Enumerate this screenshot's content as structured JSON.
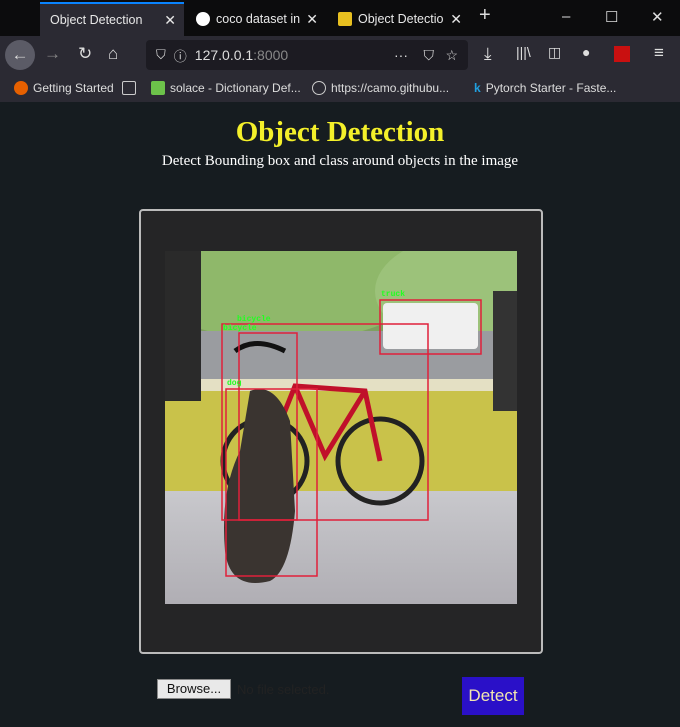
{
  "browser": {
    "tabs": [
      {
        "title": "Object Detection",
        "active": true
      },
      {
        "title": "coco dataset in",
        "active": false
      },
      {
        "title": "Object Detectio",
        "active": false
      }
    ],
    "url_host": "127.0.0.1",
    "url_port": ":8000",
    "bookmarks": [
      "Getting Started",
      "solace - Dictionary Def...",
      "https://camo.githubu...",
      "Pytorch Starter - Faste..."
    ]
  },
  "page": {
    "title": "Object Detection",
    "subtitle": "Detect Bounding box and class around objects in the image",
    "detections": [
      {
        "label": "truck"
      },
      {
        "label": "bicycle"
      },
      {
        "label": "bicycle"
      },
      {
        "label": "dog"
      }
    ],
    "browse_label": "Browse...",
    "file_status": "No file selected.",
    "detect_label": "Detect"
  },
  "colors": {
    "title": "#f4f02a",
    "detect_bg": "#2a10c8",
    "box": "#e0203a",
    "box_label": "#22ff22"
  }
}
